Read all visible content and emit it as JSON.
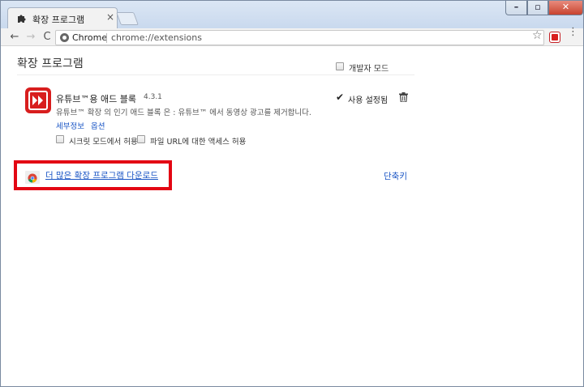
{
  "window": {
    "tab_title": "확장 프로그램",
    "tab_close": "×",
    "controls": {
      "minimize": "–",
      "maximize": "▫",
      "close": "✕"
    }
  },
  "toolbar": {
    "back": "←",
    "forward": "→",
    "reload": "C",
    "omnibox_label": "Chrome",
    "url": "chrome://extensions",
    "bookmark_star": "☆",
    "menu": "⋮"
  },
  "page": {
    "title": "확장 프로그램",
    "developer_mode_label": "개발자 모드",
    "developer_mode_checked": false
  },
  "extension": {
    "name": "유튜브™용 애드 블록",
    "version": "4.3.1",
    "description": "유튜브™ 확장 의 인기 애드 블록 은 : 유튜브™ 에서 동영상 광고를 제거합니다.",
    "details_link": "세부정보",
    "options_link": "옵션",
    "enabled_label": "사용 설정됨",
    "enabled_checked": true,
    "incognito_label": "시크릿 모드에서 허용",
    "file_url_label": "파일 URL에 대한 액세스 허용",
    "icon_color": "#d81e1e"
  },
  "footer": {
    "get_more_link": "더 많은 확장 프로그램 다운로드",
    "shortcuts_link": "단축키",
    "highlight_color": "#e30613"
  }
}
